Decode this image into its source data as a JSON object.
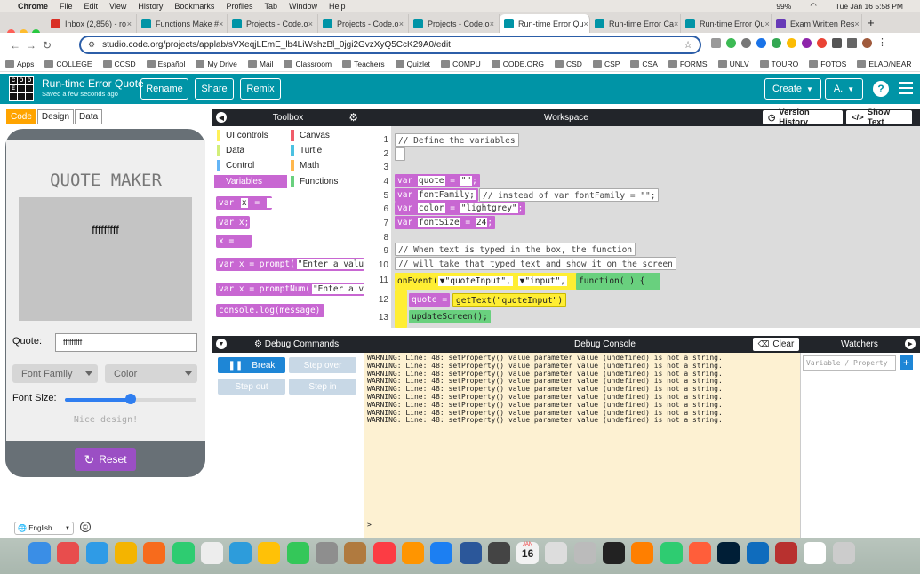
{
  "mac_menu": {
    "app": "Chrome",
    "items": [
      "File",
      "Edit",
      "View",
      "History",
      "Bookmarks",
      "Profiles",
      "Tab",
      "Window",
      "Help"
    ],
    "battery": "99%",
    "datetime": "Tue Jan 16  5:58 PM"
  },
  "tabs": [
    {
      "label": "Inbox (2,856) - ro",
      "color": "#d93025",
      "active": false
    },
    {
      "label": "Functions Make #",
      "color": "#0094a6",
      "active": false
    },
    {
      "label": "Projects - Code.o",
      "color": "#0094a6",
      "active": false
    },
    {
      "label": "Projects - Code.o",
      "color": "#0094a6",
      "active": false
    },
    {
      "label": "Projects - Code.o",
      "color": "#0094a6",
      "active": false
    },
    {
      "label": "Run-time Error Qu",
      "color": "#0094a6",
      "active": true
    },
    {
      "label": "Run-time Error Ca",
      "color": "#0094a6",
      "active": false
    },
    {
      "label": "Run-time Error Qu",
      "color": "#0094a6",
      "active": false
    },
    {
      "label": "Exam Written Res",
      "color": "#673ab7",
      "active": false
    }
  ],
  "address": {
    "url": "studio.code.org/projects/applab/sVXeqjLEmE_lb4LiWshzBl_0jgi2GvzXyQ5CcK29A0/edit"
  },
  "bookmarks": [
    "Apps",
    "COLLEGE",
    "CCSD",
    "Español",
    "My Drive",
    "Mail",
    "Classroom",
    "Teachers",
    "Quizlet",
    "COMPU",
    "CODE.ORG",
    "CSD",
    "CSP",
    "CSA",
    "FORMS",
    "UNLV",
    "TOURO",
    "FOTOS",
    "ELAD/NEAR"
  ],
  "header": {
    "project_name": "Run-time Error Quote",
    "saved": "Saved a few seconds ago",
    "rename": "Rename",
    "share": "Share",
    "remix": "Remix",
    "create": "Create",
    "account": "A.",
    "help": "?",
    "logo_letters": [
      "C",
      "O",
      "D",
      "E",
      "",
      "",
      ""
    ]
  },
  "modes": {
    "code": "Code",
    "design": "Design",
    "data": "Data"
  },
  "app": {
    "title": "QUOTE MAKER",
    "quote_display": "fffffffff",
    "quote_label": "Quote:",
    "quote_value": "fffffffff",
    "font_family": "Font Family",
    "color": "Color",
    "font_size_label": "Font Size:",
    "font_size_fraction": 0.5,
    "message": "Nice design!",
    "reset": "Reset",
    "language": "English"
  },
  "toolbox": {
    "title": "Toolbox",
    "categories": [
      {
        "name": "UI controls",
        "color": "#fff159"
      },
      {
        "name": "Canvas",
        "color": "#f05c6a"
      },
      {
        "name": "Data",
        "color": "#d3ee7a"
      },
      {
        "name": "Turtle",
        "color": "#4bc1e1"
      },
      {
        "name": "Control",
        "color": "#64b5f6"
      },
      {
        "name": "Math",
        "color": "#ffb74d"
      },
      {
        "name": "Variables",
        "color": "#c867d2"
      },
      {
        "name": "Functions",
        "color": "#69d07e"
      }
    ],
    "blocks": {
      "b1_var": "var",
      "b1_x": "x",
      "b1_eq": "=",
      "b2": "var x;",
      "b3": "x = ",
      "b4_pre": "var x = prompt(",
      "b4_s": "\"Enter a valu",
      "b5_pre": "var x = promptNum(",
      "b5_s": "\"Enter a v",
      "b6": "console.log(message)"
    }
  },
  "workspace": {
    "title": "Workspace",
    "version_history": "Version History",
    "show_text": "Show Text",
    "line_numbers": [
      "1",
      "2",
      "3",
      "4",
      "5",
      "6",
      "7",
      "8",
      "9",
      "10",
      "11",
      "12",
      "13"
    ],
    "lines": {
      "l1": "// Define the variables",
      "l4_kw": "var",
      "l4_name": "quote",
      "l4_eq": "=",
      "l4_val": "\"\"",
      "l5_kw": "var",
      "l5_name": "fontFamily;",
      "l5_cmt": "//  instead of var fontFamily = \"\";",
      "l6_kw": "var",
      "l6_name": "color",
      "l6_eq": "=",
      "l6_val": "\"lightgrey\"",
      "l7_kw": "var",
      "l7_name": "fontSize",
      "l7_eq": "=",
      "l7_val": "24",
      "l9": "// When text is typed in the box, the function",
      "l10": "// will take that typed text and show it on the screen",
      "l11_on": "onEvent(",
      "l11_id": "\"quoteInput\",",
      "l11_ev": "\"input\",",
      "l11_fn": "function( ) {",
      "l12_q": "quote = ",
      "l12_get": "getText(\"quoteInput\")",
      "l13": "updateScreen();"
    }
  },
  "debug": {
    "commands_title": "Debug Commands",
    "console_title": "Debug Console",
    "watchers_title": "Watchers",
    "clear": "Clear",
    "break": "Break",
    "step_over": "Step over",
    "step_out": "Step out",
    "step_in": "Step in",
    "watch_placeholder": "Variable / Property",
    "prompt": ">",
    "log": [
      "WARNING: Line: 48: setProperty() value parameter value (undefined) is not a string.",
      "WARNING: Line: 48: setProperty() value parameter value (undefined) is not a string.",
      "WARNING: Line: 48: setProperty() value parameter value (undefined) is not a string.",
      "WARNING: Line: 48: setProperty() value parameter value (undefined) is not a string.",
      "WARNING: Line: 48: setProperty() value parameter value (undefined) is not a string.",
      "WARNING: Line: 48: setProperty() value parameter value (undefined) is not a string.",
      "WARNING: Line: 48: setProperty() value parameter value (undefined) is not a string.",
      "WARNING: Line: 48: setProperty() value parameter value (undefined) is not a string.",
      "WARNING: Line: 48: setProperty() value parameter value (undefined) is not a string."
    ]
  },
  "dock": {
    "calendar_month": "JAN",
    "calendar_day": "16",
    "badge": "4",
    "badge2": "1"
  }
}
